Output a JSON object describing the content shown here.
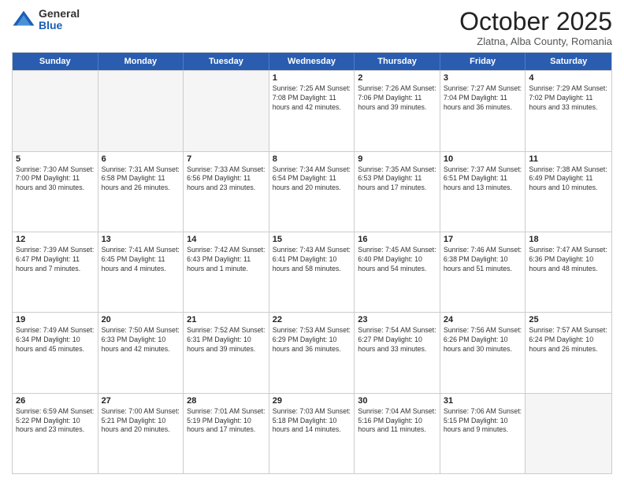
{
  "logo": {
    "general": "General",
    "blue": "Blue"
  },
  "title": "October 2025",
  "subtitle": "Zlatna, Alba County, Romania",
  "days": [
    "Sunday",
    "Monday",
    "Tuesday",
    "Wednesday",
    "Thursday",
    "Friday",
    "Saturday"
  ],
  "weeks": [
    [
      {
        "day": "",
        "content": ""
      },
      {
        "day": "",
        "content": ""
      },
      {
        "day": "",
        "content": ""
      },
      {
        "day": "1",
        "content": "Sunrise: 7:25 AM\nSunset: 7:08 PM\nDaylight: 11 hours and 42 minutes."
      },
      {
        "day": "2",
        "content": "Sunrise: 7:26 AM\nSunset: 7:06 PM\nDaylight: 11 hours and 39 minutes."
      },
      {
        "day": "3",
        "content": "Sunrise: 7:27 AM\nSunset: 7:04 PM\nDaylight: 11 hours and 36 minutes."
      },
      {
        "day": "4",
        "content": "Sunrise: 7:29 AM\nSunset: 7:02 PM\nDaylight: 11 hours and 33 minutes."
      }
    ],
    [
      {
        "day": "5",
        "content": "Sunrise: 7:30 AM\nSunset: 7:00 PM\nDaylight: 11 hours and 30 minutes."
      },
      {
        "day": "6",
        "content": "Sunrise: 7:31 AM\nSunset: 6:58 PM\nDaylight: 11 hours and 26 minutes."
      },
      {
        "day": "7",
        "content": "Sunrise: 7:33 AM\nSunset: 6:56 PM\nDaylight: 11 hours and 23 minutes."
      },
      {
        "day": "8",
        "content": "Sunrise: 7:34 AM\nSunset: 6:54 PM\nDaylight: 11 hours and 20 minutes."
      },
      {
        "day": "9",
        "content": "Sunrise: 7:35 AM\nSunset: 6:53 PM\nDaylight: 11 hours and 17 minutes."
      },
      {
        "day": "10",
        "content": "Sunrise: 7:37 AM\nSunset: 6:51 PM\nDaylight: 11 hours and 13 minutes."
      },
      {
        "day": "11",
        "content": "Sunrise: 7:38 AM\nSunset: 6:49 PM\nDaylight: 11 hours and 10 minutes."
      }
    ],
    [
      {
        "day": "12",
        "content": "Sunrise: 7:39 AM\nSunset: 6:47 PM\nDaylight: 11 hours and 7 minutes."
      },
      {
        "day": "13",
        "content": "Sunrise: 7:41 AM\nSunset: 6:45 PM\nDaylight: 11 hours and 4 minutes."
      },
      {
        "day": "14",
        "content": "Sunrise: 7:42 AM\nSunset: 6:43 PM\nDaylight: 11 hours and 1 minute."
      },
      {
        "day": "15",
        "content": "Sunrise: 7:43 AM\nSunset: 6:41 PM\nDaylight: 10 hours and 58 minutes."
      },
      {
        "day": "16",
        "content": "Sunrise: 7:45 AM\nSunset: 6:40 PM\nDaylight: 10 hours and 54 minutes."
      },
      {
        "day": "17",
        "content": "Sunrise: 7:46 AM\nSunset: 6:38 PM\nDaylight: 10 hours and 51 minutes."
      },
      {
        "day": "18",
        "content": "Sunrise: 7:47 AM\nSunset: 6:36 PM\nDaylight: 10 hours and 48 minutes."
      }
    ],
    [
      {
        "day": "19",
        "content": "Sunrise: 7:49 AM\nSunset: 6:34 PM\nDaylight: 10 hours and 45 minutes."
      },
      {
        "day": "20",
        "content": "Sunrise: 7:50 AM\nSunset: 6:33 PM\nDaylight: 10 hours and 42 minutes."
      },
      {
        "day": "21",
        "content": "Sunrise: 7:52 AM\nSunset: 6:31 PM\nDaylight: 10 hours and 39 minutes."
      },
      {
        "day": "22",
        "content": "Sunrise: 7:53 AM\nSunset: 6:29 PM\nDaylight: 10 hours and 36 minutes."
      },
      {
        "day": "23",
        "content": "Sunrise: 7:54 AM\nSunset: 6:27 PM\nDaylight: 10 hours and 33 minutes."
      },
      {
        "day": "24",
        "content": "Sunrise: 7:56 AM\nSunset: 6:26 PM\nDaylight: 10 hours and 30 minutes."
      },
      {
        "day": "25",
        "content": "Sunrise: 7:57 AM\nSunset: 6:24 PM\nDaylight: 10 hours and 26 minutes."
      }
    ],
    [
      {
        "day": "26",
        "content": "Sunrise: 6:59 AM\nSunset: 5:22 PM\nDaylight: 10 hours and 23 minutes."
      },
      {
        "day": "27",
        "content": "Sunrise: 7:00 AM\nSunset: 5:21 PM\nDaylight: 10 hours and 20 minutes."
      },
      {
        "day": "28",
        "content": "Sunrise: 7:01 AM\nSunset: 5:19 PM\nDaylight: 10 hours and 17 minutes."
      },
      {
        "day": "29",
        "content": "Sunrise: 7:03 AM\nSunset: 5:18 PM\nDaylight: 10 hours and 14 minutes."
      },
      {
        "day": "30",
        "content": "Sunrise: 7:04 AM\nSunset: 5:16 PM\nDaylight: 10 hours and 11 minutes."
      },
      {
        "day": "31",
        "content": "Sunrise: 7:06 AM\nSunset: 5:15 PM\nDaylight: 10 hours and 9 minutes."
      },
      {
        "day": "",
        "content": ""
      }
    ]
  ]
}
